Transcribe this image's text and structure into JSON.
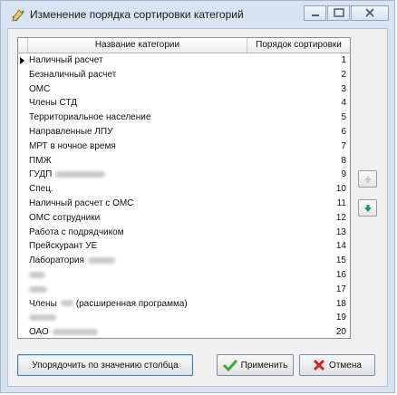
{
  "window": {
    "title": "Изменение порядка сортировки категорий",
    "icon": "pencil-check-icon"
  },
  "grid": {
    "columns": [
      "Название категории",
      "Порядок сортировки"
    ],
    "rows": [
      {
        "name": "Наличный расчет",
        "order": "1",
        "selected": true
      },
      {
        "name": "Безналичный расчет",
        "order": "2"
      },
      {
        "name": "ОМС",
        "order": "3"
      },
      {
        "name": "Члены СТД",
        "order": "4"
      },
      {
        "name": "Территориальное население",
        "order": "5"
      },
      {
        "name": "Направленные ЛПУ",
        "order": "6"
      },
      {
        "name": "МРТ в ночное время",
        "order": "7"
      },
      {
        "name": "ПМЖ",
        "order": "8"
      },
      {
        "name": "ГУДП",
        "order": "9",
        "redacted_after": true
      },
      {
        "name": "Спец.",
        "order": "10"
      },
      {
        "name": "Наличный расчет с ОМС",
        "order": "11"
      },
      {
        "name": "ОМС сотрудники",
        "order": "12"
      },
      {
        "name": "Работа с подрядчиком",
        "order": "13"
      },
      {
        "name": "Прейскурант УЕ",
        "order": "14"
      },
      {
        "name": "Лаборатория",
        "order": "15",
        "redacted_after": true
      },
      {
        "name": "",
        "order": "16",
        "redacted_full": true
      },
      {
        "name": "",
        "order": "17",
        "redacted_full": true
      },
      {
        "name": "Члены",
        "suffix": "(расширенная программа)",
        "order": "18",
        "redacted_middle": true
      },
      {
        "name": "",
        "order": "19",
        "redacted_full": true
      },
      {
        "name": "ОАО",
        "order": "20",
        "redacted_after": true
      }
    ]
  },
  "side_buttons": {
    "up": "arrow-up-icon",
    "down": "arrow-down-icon"
  },
  "buttons": {
    "sort_label": "Упорядочить по значению столбца",
    "apply_label": "Применить",
    "cancel_label": "Отмена"
  },
  "colors": {
    "accent": "#3c7fb1",
    "apply_icon": "#3aa935",
    "cancel_icon": "#e02020"
  }
}
